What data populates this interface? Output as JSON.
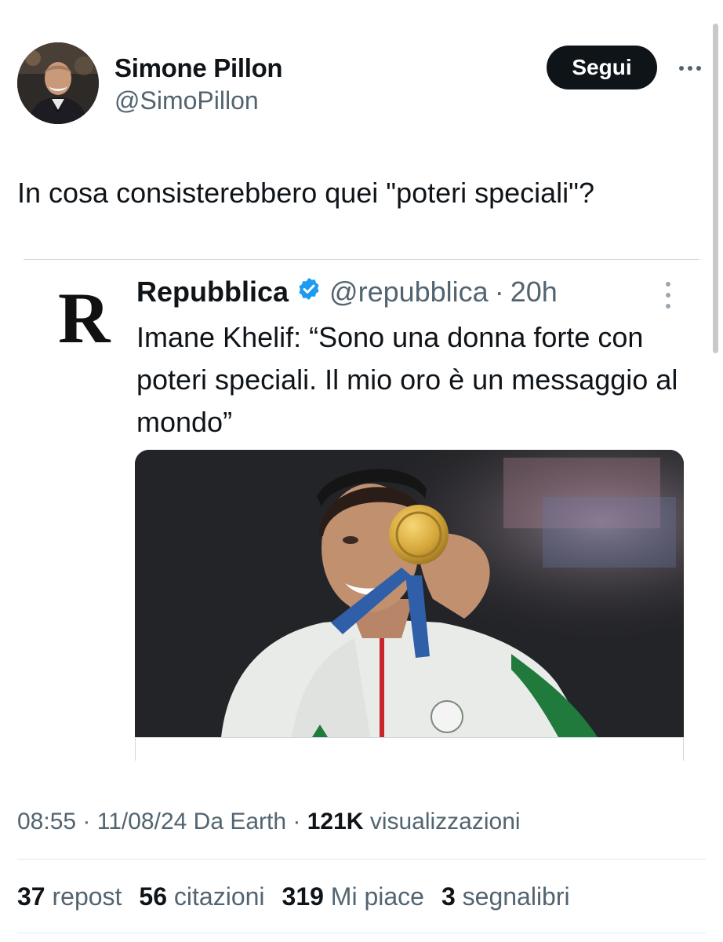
{
  "author": {
    "display_name": "Simone Pillon",
    "handle": "@SimoPillon",
    "follow_label": "Segui"
  },
  "tweet": {
    "text": "In cosa consisterebbero quei \"poteri speciali\"?"
  },
  "quoted_tweet": {
    "logo_letter": "R",
    "name": "Repubblica",
    "handle": "@repubblica",
    "separator": "·",
    "time": "20h",
    "text": "Imane Khelif: “Sono una donna forte con poteri speciali. Il mio oro è un messaggio al mondo”"
  },
  "meta": {
    "time": "08:55",
    "sep1": "·",
    "date": "11/08/24",
    "source": "Da Earth",
    "sep2": "·",
    "views_count": "121K",
    "views_label": "visualizzazioni"
  },
  "stats": {
    "reposts_count": "37",
    "reposts_label": "repost",
    "quotes_count": "56",
    "quotes_label": "citazioni",
    "likes_count": "319",
    "likes_label": "Mi piace",
    "bookmarks_count": "3",
    "bookmarks_label": "segnalibri"
  },
  "colors": {
    "text_primary": "#0f1419",
    "text_secondary": "#536471",
    "verified_blue": "#1d9bf0",
    "button_bg": "#0f1419"
  },
  "icons": {
    "more": "more-horizontal-icon",
    "quote_more": "more-vertical-icon",
    "verified": "verified-badge-icon"
  }
}
